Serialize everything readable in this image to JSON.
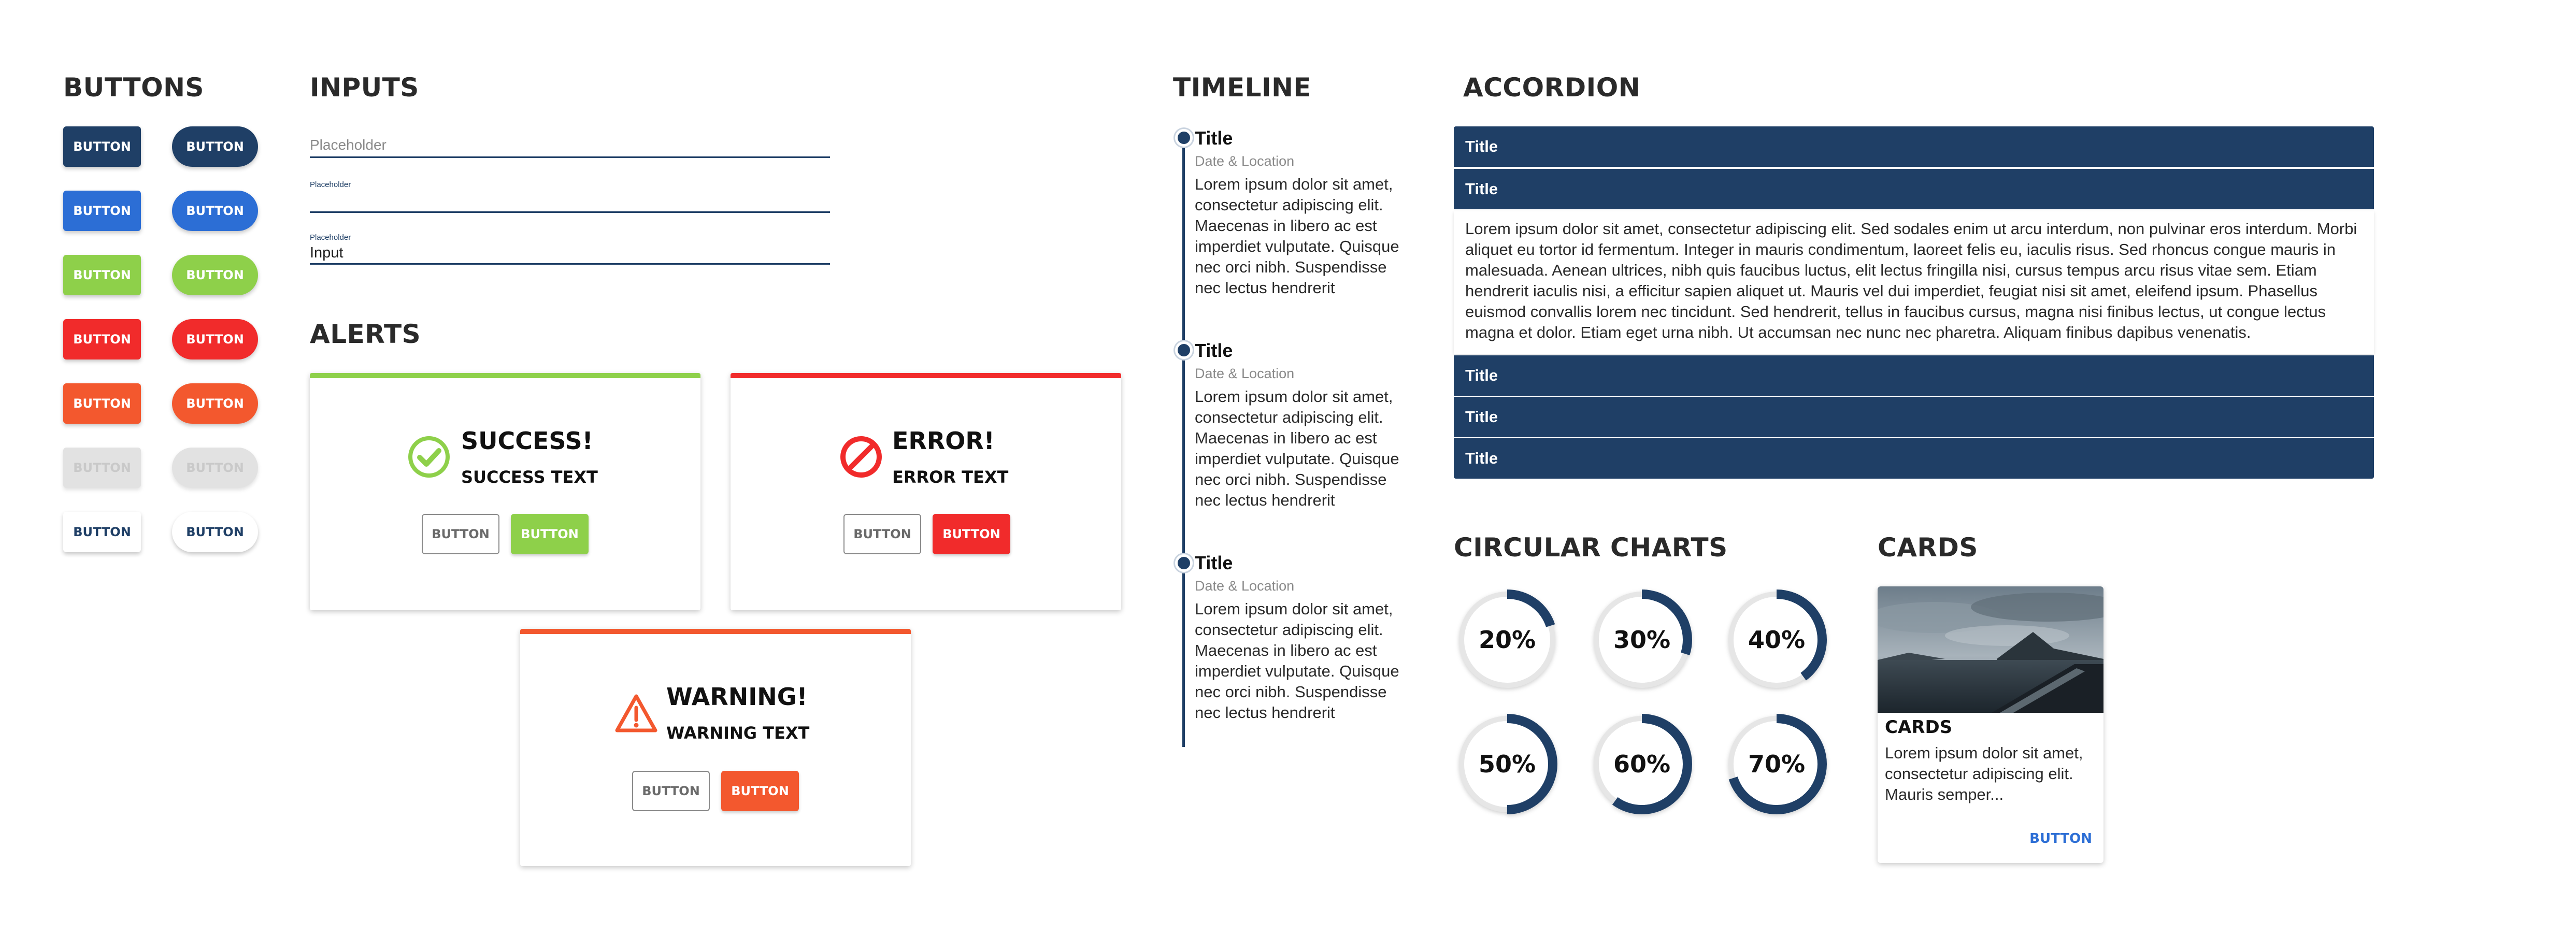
{
  "sections": {
    "buttons": "BUTTONS",
    "inputs": "INPUTS",
    "alerts": "ALERTS",
    "timeline": "TIMELINE",
    "accordion": "ACCORDION",
    "circular_charts": "CIRCULAR CHARTS",
    "cards": "CARDS"
  },
  "buttons": {
    "label": "BUTTON",
    "variants": [
      {
        "name": "dark-navy",
        "bg": "#1f3f66",
        "fg": "#ffffff"
      },
      {
        "name": "blue",
        "bg": "#2c6ed5",
        "fg": "#ffffff"
      },
      {
        "name": "green",
        "bg": "#8ed04a",
        "fg": "#ffffff"
      },
      {
        "name": "red",
        "bg": "#f12b2b",
        "fg": "#ffffff"
      },
      {
        "name": "orange",
        "bg": "#f3582e",
        "fg": "#ffffff"
      },
      {
        "name": "disabled",
        "bg": "#e2e2e2",
        "fg": "#c9c9c9"
      },
      {
        "name": "white",
        "bg": "#ffffff",
        "fg": "#1f3f66"
      }
    ]
  },
  "inputs": {
    "field1_placeholder": "Placeholder",
    "field2_label": "Placeholder",
    "field3_label": "Placeholder",
    "field3_value": "Input"
  },
  "alerts": {
    "success": {
      "title": "SUCCESS!",
      "text": "SUCCESS TEXT",
      "secondary": "BUTTON",
      "primary": "BUTTON",
      "color": "#8ed04a"
    },
    "error": {
      "title": "ERROR!",
      "text": "ERROR TEXT",
      "secondary": "BUTTON",
      "primary": "BUTTON",
      "color": "#f12b2b"
    },
    "warning": {
      "title": "WARNING!",
      "text": "WARNING TEXT",
      "secondary": "BUTTON",
      "primary": "BUTTON",
      "color": "#f3582e"
    }
  },
  "timeline": {
    "items": [
      {
        "title": "Title",
        "meta": "Date & Location",
        "body": "Lorem ipsum dolor sit amet, consectetur adipiscing elit. Maecenas in libero ac est imperdiet vulputate. Quisque nec orci nibh. Suspendisse nec lectus hendrerit"
      },
      {
        "title": "Title",
        "meta": "Date & Location",
        "body": "Lorem ipsum dolor sit amet, consectetur adipiscing elit. Maecenas in libero ac est imperdiet vulputate. Quisque nec orci nibh. Suspendisse nec lectus hendrerit"
      },
      {
        "title": "Title",
        "meta": "Date & Location",
        "body": "Lorem ipsum dolor sit amet, consectetur adipiscing elit. Maecenas in libero ac est imperdiet vulputate. Quisque nec orci nibh. Suspendisse nec lectus hendrerit"
      }
    ]
  },
  "accordion": {
    "headers": [
      "Title",
      "Title",
      "Title",
      "Title",
      "Title"
    ],
    "open_body": "Lorem ipsum dolor sit amet, consectetur adipiscing elit. Sed sodales enim ut arcu interdum, non pulvinar eros interdum. Morbi aliquet eu tortor id fermentum. Integer in mauris condimentum, laoreet felis eu, iaculis risus. Sed rhoncus congue mauris in malesuada. Aenean ultrices, nibh quis faucibus luctus, elit lectus fringilla nisi, cursus tempus arcu risus vitae sem. Etiam hendrerit iaculis nisi, a efficitur sapien aliquet ut. Mauris vel dui imperdiet, feugiat nisi sit amet, eleifend ipsum. Phasellus euismod convallis lorem nec tincidunt. Sed hendrerit, tellus in faucibus cursus, magna nisi finibus lectus, ut congue lectus magna et dolor. Etiam eget urna nibh. Ut accumsan nec nunc nec pharetra. Aliquam finibus dapibus venenatis."
  },
  "circular_charts": {
    "ring_color": "#1f3f66",
    "track_color": "#e6e6e6",
    "charts": [
      {
        "label": "20%",
        "value": 0.2
      },
      {
        "label": "30%",
        "value": 0.3
      },
      {
        "label": "40%",
        "value": 0.4
      },
      {
        "label": "50%",
        "value": 0.5
      },
      {
        "label": "60%",
        "value": 0.6
      },
      {
        "label": "70%",
        "value": 0.7
      }
    ]
  },
  "card": {
    "title": "CARDS",
    "text": "Lorem ipsum dolor sit amet, consectetur adipiscing elit. Mauris semper...",
    "button": "BUTTON"
  }
}
